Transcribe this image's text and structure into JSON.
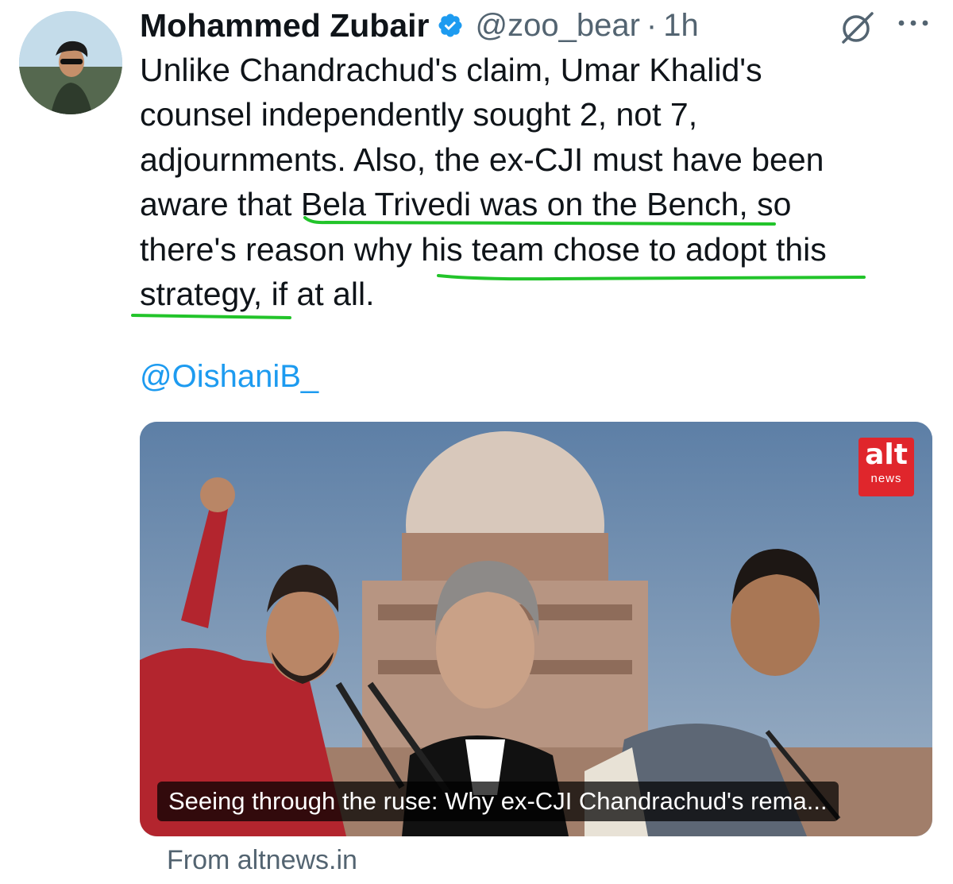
{
  "author": {
    "name": "Mohammed Zubair",
    "handle": "@zoo_bear",
    "separator": "·",
    "time": "1h",
    "verified": true
  },
  "icons": {
    "verified": "verified-badge-icon",
    "grok": "grok-icon",
    "more": "more-icon"
  },
  "tweet": {
    "lines": [
      "Unlike Chandrachud's claim, Umar Khalid's",
      "counsel independently sought 2, not 7,",
      "adjournments. Also, the ex-CJI must have been",
      "aware that Bela Trivedi was on the Bench, so",
      "there's reason why his team chose to adopt this",
      "strategy, if at all."
    ],
    "mention": "@OishaniB_"
  },
  "card": {
    "logo_main": "alt",
    "logo_sub": "news",
    "caption": "Seeing through the ruse: Why ex-CJI Chandrachud's rema...",
    "source": "From altnews.in"
  },
  "colors": {
    "text": "#0f1419",
    "secondary": "#536471",
    "link": "#1d9bf0",
    "verified": "#1d9bf0",
    "highlight_underline": "#22c42a",
    "logo_red": "#e0262c"
  }
}
